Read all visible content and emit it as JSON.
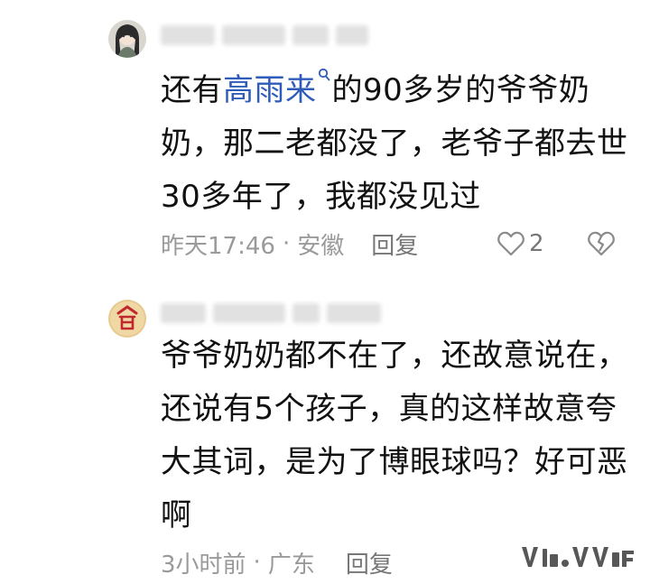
{
  "comments": [
    {
      "avatar_icon": "avatar-girl-illustration",
      "body_before_mention": "还有",
      "mention": "高雨来",
      "body_after_mention": "的90多岁的爷爷奶",
      "body_line2": "奶，那二老都没了，老爷子都去世",
      "body_line3": "30多年了，我都没见过",
      "time": "昨天17:46",
      "dot": "·",
      "location": "安徽",
      "reply_label": "回复",
      "like_count": "2",
      "like_icon": "heart-outline-icon",
      "dislike_icon": "broken-heart-icon"
    },
    {
      "avatar_icon": "avatar-red-character",
      "body_line1": "爷爷奶奶都不在了，还故意说在，",
      "body_line2": "还说有5个孩子，真的这样故意夸",
      "body_line3": "大其词，是为了博眼球吗？好可恶",
      "body_line4": "啊",
      "time": "3小时前",
      "dot": "·",
      "location": "广东",
      "reply_label": "回复"
    }
  ],
  "colors": {
    "mention": "#2e5cb8",
    "meta_text": "#9a9a9a",
    "body_text": "#111111"
  }
}
